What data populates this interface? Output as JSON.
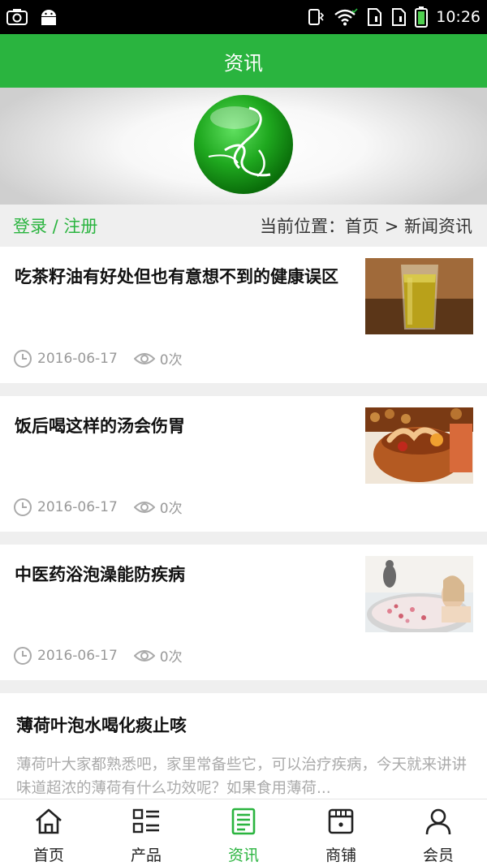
{
  "status_bar": {
    "time": "10:26",
    "icons": [
      "screenshot-icon",
      "android-icon",
      "vibrate-icon",
      "wifi-icon",
      "sim1-icon",
      "sim2-icon",
      "battery-icon"
    ]
  },
  "header": {
    "title": "资讯"
  },
  "banner": {
    "logo": "green-sphere-logo"
  },
  "location_bar": {
    "login_register": "登录 / 注册",
    "breadcrumb": "当前位置：首页 > 新闻资讯"
  },
  "articles": [
    {
      "title": "吃茶籽油有好处但也有意想不到的健康误区",
      "date": "2016-06-17",
      "views": "0次",
      "thumb": "tea-seed-oil-glass"
    },
    {
      "title": "饭后喝这样的汤会伤胃",
      "date": "2016-06-17",
      "views": "0次",
      "thumb": "soup-clay-pot"
    },
    {
      "title": "中医药浴泡澡能防疾病",
      "date": "2016-06-17",
      "views": "0次",
      "thumb": "herbal-bath"
    },
    {
      "title": "薄荷叶泡水喝化痰止咳",
      "excerpt": "薄荷叶大家都熟悉吧，家里常备些它，可以治疗疾病，今天就来讲讲味道超浓的薄荷有什么功效呢？如果食用薄荷..."
    }
  ],
  "tabbar": {
    "items": [
      {
        "label": "首页",
        "icon": "home-icon"
      },
      {
        "label": "产品",
        "icon": "list-icon"
      },
      {
        "label": "资讯",
        "icon": "news-icon",
        "active": true
      },
      {
        "label": "商铺",
        "icon": "shop-icon"
      },
      {
        "label": "会员",
        "icon": "user-icon"
      }
    ]
  },
  "colors": {
    "accent": "#2ab43f",
    "background": "#efefef",
    "meta": "#999999"
  }
}
